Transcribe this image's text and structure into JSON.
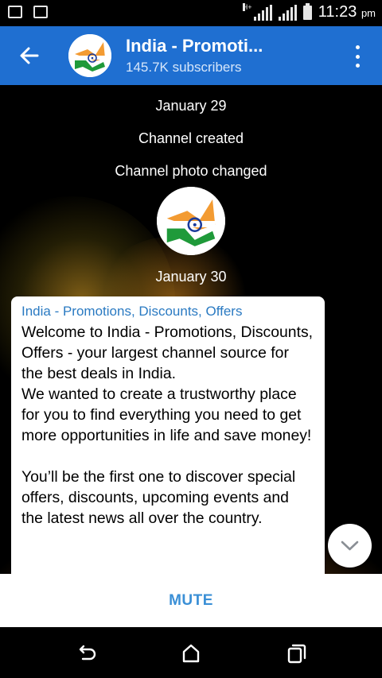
{
  "status_bar": {
    "time": "11:23",
    "ampm": "pm",
    "network": "H+"
  },
  "header": {
    "title": "India - Promoti...",
    "subtitle": "145.7K subscribers",
    "accent_color": "#1f6fd1"
  },
  "chat": {
    "date_1": "January 29",
    "service_1": "Channel created",
    "service_2": "Channel photo changed",
    "date_2": "January 30",
    "message": {
      "sender": "India - Promotions, Discounts, Offers",
      "text": "Welcome to India - Promotions, Discounts, Offers - your largest channel source for the best deals in India.\nWe wanted to create a trustworthy place for you to find everything you need to get more opportunities in life and save money!\n\nYou’ll be the first one to discover special offers, discounts, upcoming events and the latest news all over the country."
    }
  },
  "bottom": {
    "mute_label": "MUTE"
  },
  "icons": {
    "back": "arrow-left-icon",
    "menu": "more-vert-icon",
    "scroll": "chevron-down-icon",
    "nav_back": "nav-back-icon",
    "nav_home": "nav-home-icon",
    "nav_recent": "nav-recent-icon"
  }
}
